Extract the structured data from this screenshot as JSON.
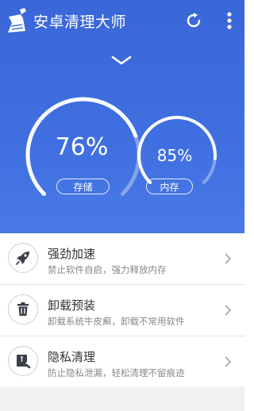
{
  "header": {
    "title": "安卓清理大师",
    "icons": {
      "app": "broom-icon",
      "refresh": "refresh-icon",
      "menu": "more-vert-icon"
    }
  },
  "expand": {
    "icon": "chevron-down-icon"
  },
  "gauges": {
    "storage": {
      "value_text": "76%",
      "label": "存储",
      "percent": 76
    },
    "memory": {
      "value_text": "85%",
      "label": "内存",
      "percent": 85
    }
  },
  "list": {
    "items": [
      {
        "title": "强劲加速",
        "subtitle": "禁止软件自启，强力释放内存",
        "icon": "rocket-icon"
      },
      {
        "title": "卸载预装",
        "subtitle": "卸载系统牛皮癣，卸载不常用软件",
        "icon": "trash-icon"
      },
      {
        "title": "隐私清理",
        "subtitle": "防止隐私泄漏，轻松清理不留痕迹",
        "icon": "privacy-clean-icon"
      }
    ]
  },
  "colors": {
    "hero_blue": "#3f6fe0",
    "icon_dark": "#3a3f4a",
    "text_primary": "#333333",
    "text_secondary": "#888888"
  }
}
